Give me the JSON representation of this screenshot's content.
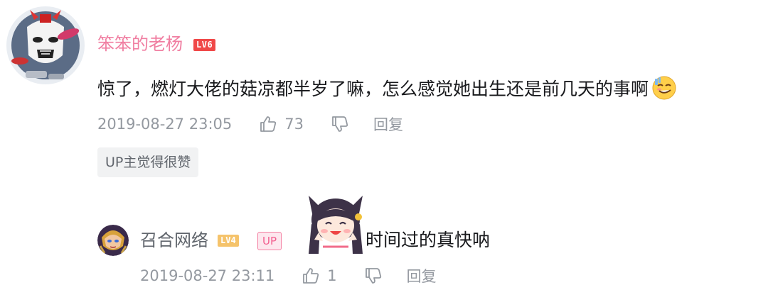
{
  "comment": {
    "username": "笨笨的老杨",
    "level": "LV6",
    "text": "惊了，燃灯大佬的菇凉都半岁了嘛，怎么感觉她出生还是前几天的事啊",
    "emoji": "awkward-face-emoji",
    "time": "2019-08-27 23:05",
    "likes": "73",
    "reply_label": "回复",
    "up_liked_tag": "UP主觉得很赞"
  },
  "reply": {
    "username": "召合网络",
    "level": "LV4",
    "up_badge": "UP",
    "sticker": "cat-ear-girl-sticker",
    "text": "时间过的真快呐",
    "time": "2019-08-27 23:11",
    "likes": "1",
    "reply_label": "回复"
  },
  "colors": {
    "username_vip": "#f07ea1",
    "text": "#18191c",
    "meta": "#9499a0",
    "level6": "#f04848",
    "level4": "#f5c36b",
    "up_badge": "#f25d8e"
  }
}
